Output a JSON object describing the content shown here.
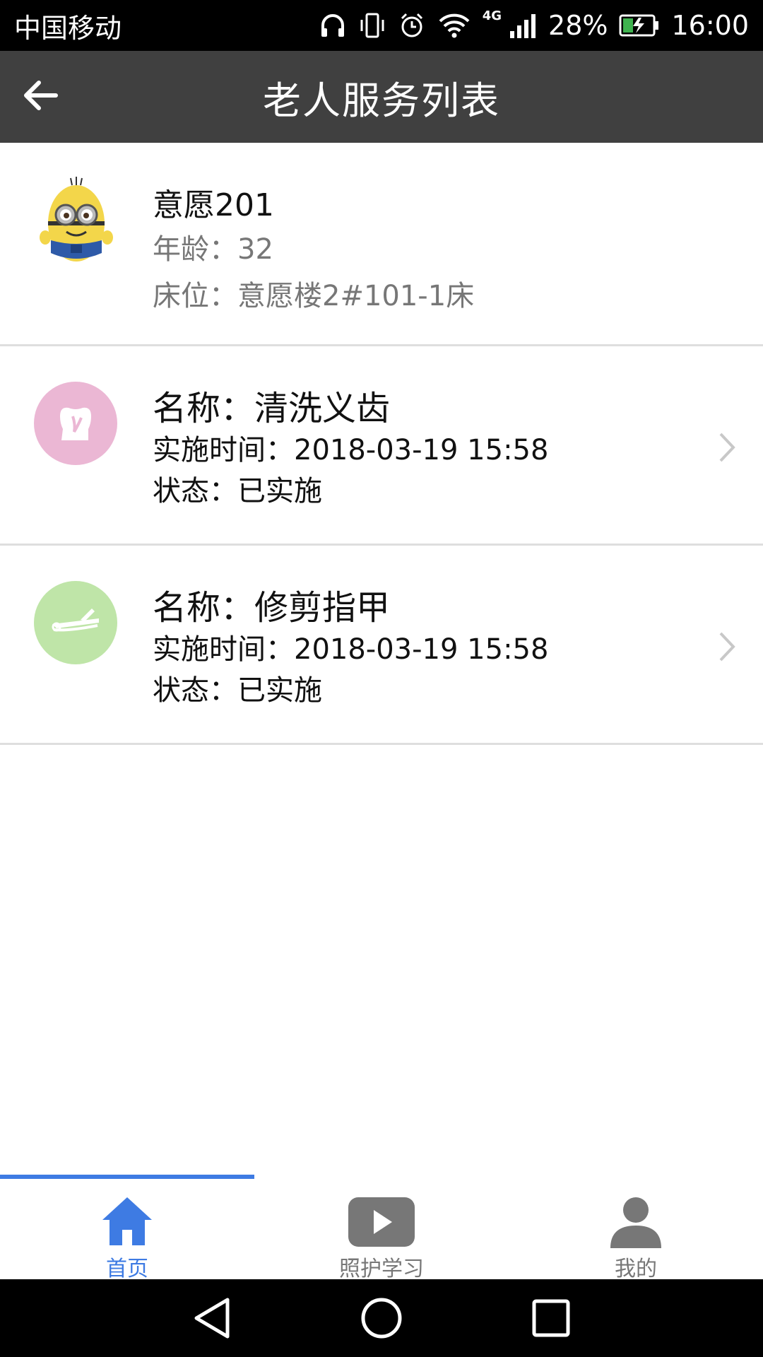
{
  "status_bar": {
    "carrier": "中国移动",
    "network": "4G",
    "battery_percent": "28%",
    "time": "16:00",
    "icons": [
      "headphones-icon",
      "vibrate-icon",
      "alarm-icon",
      "wifi-icon",
      "signal-icon",
      "battery-icon"
    ]
  },
  "header": {
    "title": "老人服务列表",
    "back_icon": "back-arrow-icon"
  },
  "elder": {
    "name": "意愿201",
    "age": "年龄：32",
    "bed": "床位：意愿楼2#101-1床",
    "avatar_icon": "minion-avatar"
  },
  "services": [
    {
      "name": "名称：清洗义齿",
      "time": "实施时间：2018-03-19 15:58",
      "status": "状态：已实施",
      "icon": "tooth-icon",
      "icon_color": "#ebb7d4"
    },
    {
      "name": "名称：修剪指甲",
      "time": "实施时间：2018-03-19 15:58",
      "status": "状态：已实施",
      "icon": "nail-clipper-icon",
      "icon_color": "#bfe5a8"
    }
  ],
  "tabs": [
    {
      "label": "首页",
      "icon": "home-icon",
      "active": true
    },
    {
      "label": "照护学习",
      "icon": "video-play-icon",
      "active": false
    },
    {
      "label": "我的",
      "icon": "user-icon",
      "active": false
    }
  ],
  "colors": {
    "accent": "#3e7be3",
    "header_bg": "#404040",
    "inactive_tab": "#777777",
    "secondary_text": "#777777"
  }
}
